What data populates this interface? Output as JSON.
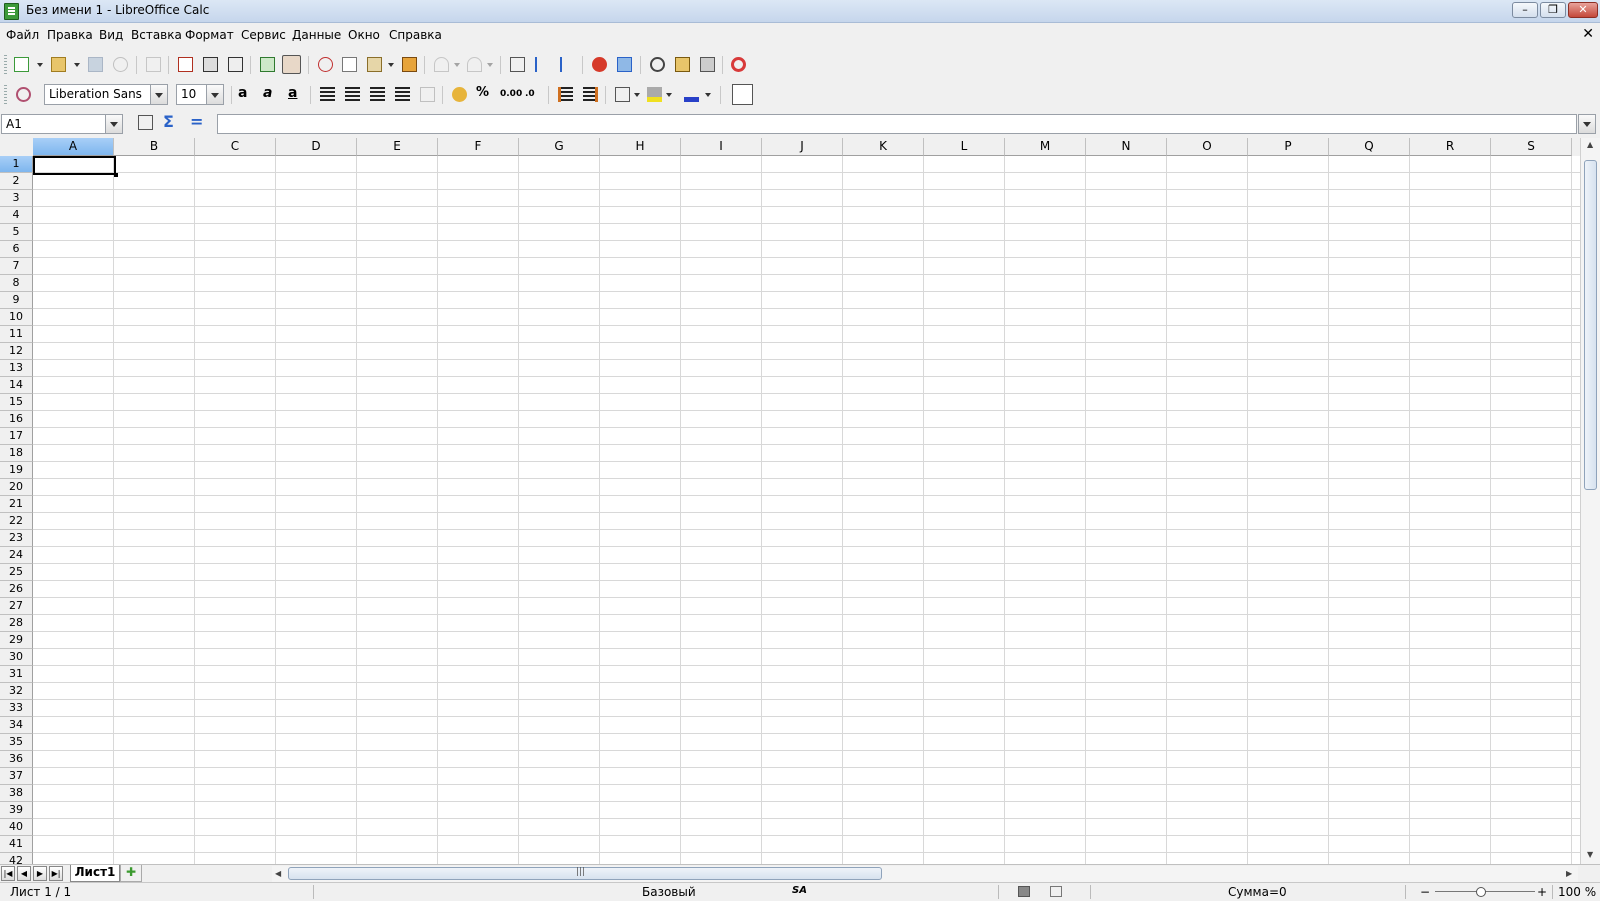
{
  "window": {
    "title": "Без имени 1 - LibreOffice Calc",
    "controls": {
      "minimize": "–",
      "maximize": "❐",
      "close": "✕"
    }
  },
  "menu": [
    "Файл",
    "Правка",
    "Вид",
    "Вставка",
    "Формат",
    "Сервис",
    "Данные",
    "Окно",
    "Справка"
  ],
  "menu_close": "✕",
  "formatting": {
    "font_name": "Liberation Sans",
    "font_size": "10",
    "percent": "%",
    "number_format": "0.00",
    "decimal_add": ".0",
    "decimal_del": ".00"
  },
  "formula_bar": {
    "cell_ref": "A1",
    "sum_icon": "Σ",
    "equals_icon": "=",
    "content": ""
  },
  "grid": {
    "columns": [
      "A",
      "B",
      "C",
      "D",
      "E",
      "F",
      "G",
      "H",
      "I",
      "J",
      "K",
      "L",
      "M",
      "N",
      "O",
      "P",
      "Q",
      "R",
      "S"
    ],
    "rows": [
      "1",
      "2",
      "3",
      "4",
      "5",
      "6",
      "7",
      "8",
      "9",
      "10",
      "11",
      "12",
      "13",
      "14",
      "15",
      "16",
      "17",
      "18",
      "19",
      "20",
      "21",
      "22",
      "23",
      "24",
      "25",
      "26",
      "27",
      "28",
      "29",
      "30",
      "31",
      "32",
      "33",
      "34",
      "35",
      "36",
      "37",
      "38",
      "39",
      "40",
      "41",
      "42"
    ],
    "selected_column": "A",
    "selected_row": "1"
  },
  "sheets": {
    "tabs": [
      "Лист1"
    ],
    "add_tab": "✚",
    "nav": [
      "|◀",
      "◀",
      "▶",
      "▶|"
    ],
    "scroll_grip": "|||"
  },
  "status": {
    "sheet": "Лист 1 / 1",
    "style": "Базовый",
    "language": "SA",
    "sum": "Сумма=0",
    "zoom_minus": "−",
    "zoom_plus": "+",
    "zoom": "100 %"
  },
  "colors": {
    "selection_header": "#7eb6ee",
    "grid_lines": "#d8d8d8"
  }
}
